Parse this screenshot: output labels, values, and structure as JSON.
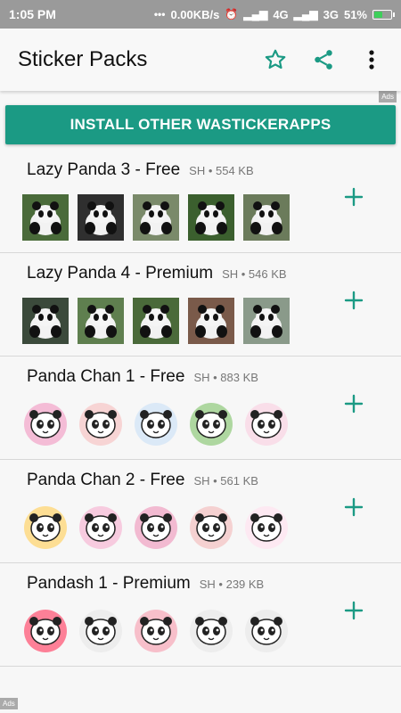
{
  "status": {
    "time": "1:05 PM",
    "net_speed": "0.00KB/s",
    "network1": "4G",
    "network2": "3G",
    "battery": "51%",
    "battery_level": 0.51
  },
  "app_bar": {
    "title": "Sticker Packs",
    "star_icon": "star-outline-icon",
    "share_icon": "share-icon",
    "menu_icon": "more-vertical-icon"
  },
  "ads": {
    "label": "Ads"
  },
  "install_button": {
    "label": "INSTALL OTHER WASTICKERAPPS"
  },
  "colors": {
    "accent": "#1b9a84",
    "status_bar": "#9a9a9a"
  },
  "packs": [
    {
      "name": "Lazy Panda 3 - Free",
      "meta": "SH • 554 KB",
      "kind": "photo"
    },
    {
      "name": "Lazy Panda 4 - Premium",
      "meta": "SH • 546 KB",
      "kind": "photo"
    },
    {
      "name": "Panda Chan 1 - Free",
      "meta": "SH • 883 KB",
      "kind": "cartoon"
    },
    {
      "name": "Panda Chan 2 - Free",
      "meta": "SH • 561 KB",
      "kind": "cartoon"
    },
    {
      "name": "Pandash 1 - Premium",
      "meta": "SH • 239 KB",
      "kind": "cartoon"
    }
  ]
}
